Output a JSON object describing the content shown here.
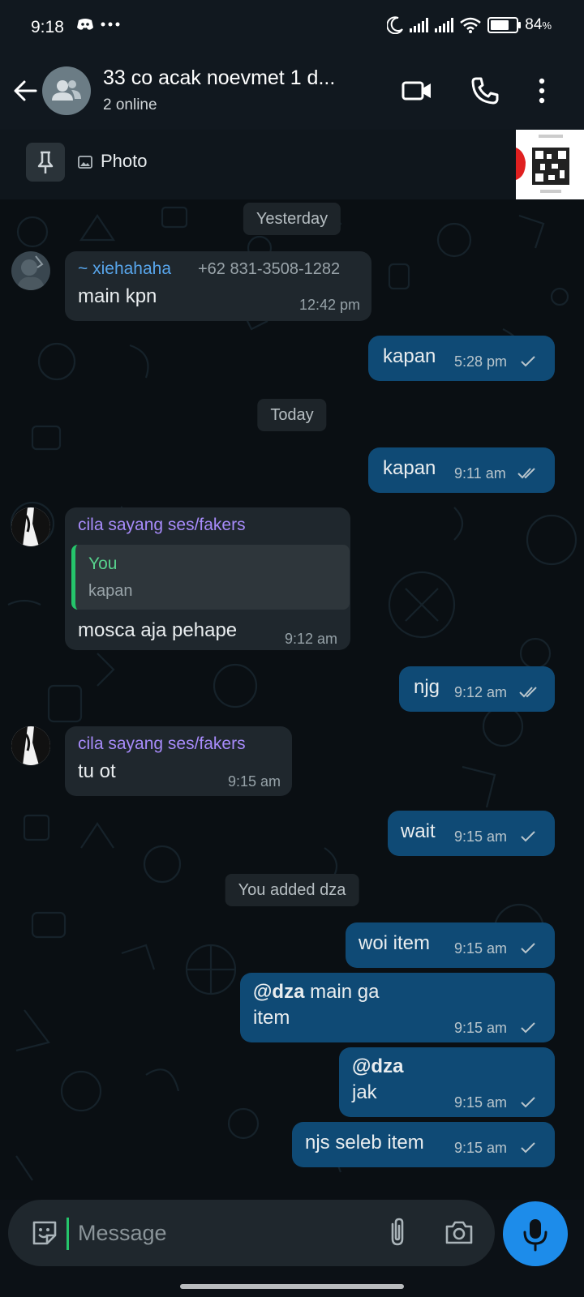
{
  "status_bar": {
    "time": "9:18",
    "battery": "84",
    "battery_unit": "%",
    "battery_level": 0.84,
    "icons": [
      "discord-icon",
      "more-dots-icon",
      "moon-icon",
      "signal-icon",
      "signal-icon",
      "wifi-icon",
      "battery-icon"
    ]
  },
  "header": {
    "title": "33 co acak noevmet 1 d...",
    "subtitle": "2 online",
    "icons": [
      "back-arrow-icon",
      "group-avatar-icon",
      "video-call-icon",
      "voice-call-icon",
      "overflow-menu-icon"
    ]
  },
  "pinned": {
    "label": "Photo",
    "icons": [
      "pin-icon",
      "photo-icon"
    ]
  },
  "chat": {
    "date_yesterday": "Yesterday",
    "date_today": "Today",
    "system_added": "You added dza",
    "messages": [
      {
        "sender": "~ xiehahaha",
        "phone": "+62 831-3508-1282",
        "text": "main kpn",
        "time": "12:42 pm"
      },
      {
        "text": "kapan",
        "time": "5:28 pm",
        "ticks": "single"
      },
      {
        "text": "kapan",
        "time": "9:11 am",
        "ticks": "double"
      },
      {
        "sender": "cila sayang ses/fakers",
        "quote_author": "You",
        "quote_text": "kapan",
        "text": "mosca aja pehape",
        "time": "9:12 am"
      },
      {
        "text": "njg",
        "time": "9:12 am",
        "ticks": "double"
      },
      {
        "sender": "cila sayang ses/fakers",
        "text": "tu ot",
        "time": "9:15 am"
      },
      {
        "text": "wait",
        "time": "9:15 am",
        "ticks": "single"
      },
      {
        "text": "woi item",
        "time": "9:15 am",
        "ticks": "single"
      },
      {
        "mention": "@dza",
        "text": " main ga",
        "text2": "item",
        "time": "9:15 am",
        "ticks": "single"
      },
      {
        "mention": "@dza",
        "text": "jak",
        "time": "9:15 am",
        "ticks": "single"
      },
      {
        "text": "njs seleb item",
        "time": "9:15 am",
        "ticks": "single"
      }
    ]
  },
  "composer": {
    "placeholder": "Message",
    "icons": [
      "sticker-icon",
      "attachment-icon",
      "camera-icon",
      "microphone-icon"
    ]
  },
  "colors": {
    "accent_green": "#25c56b",
    "outgoing_bubble": "#0f4a75",
    "incoming_bubble": "#1f272d",
    "mic_button": "#1d8cea",
    "sender1": "#58a6ec",
    "sender2": "#a78bfa"
  }
}
